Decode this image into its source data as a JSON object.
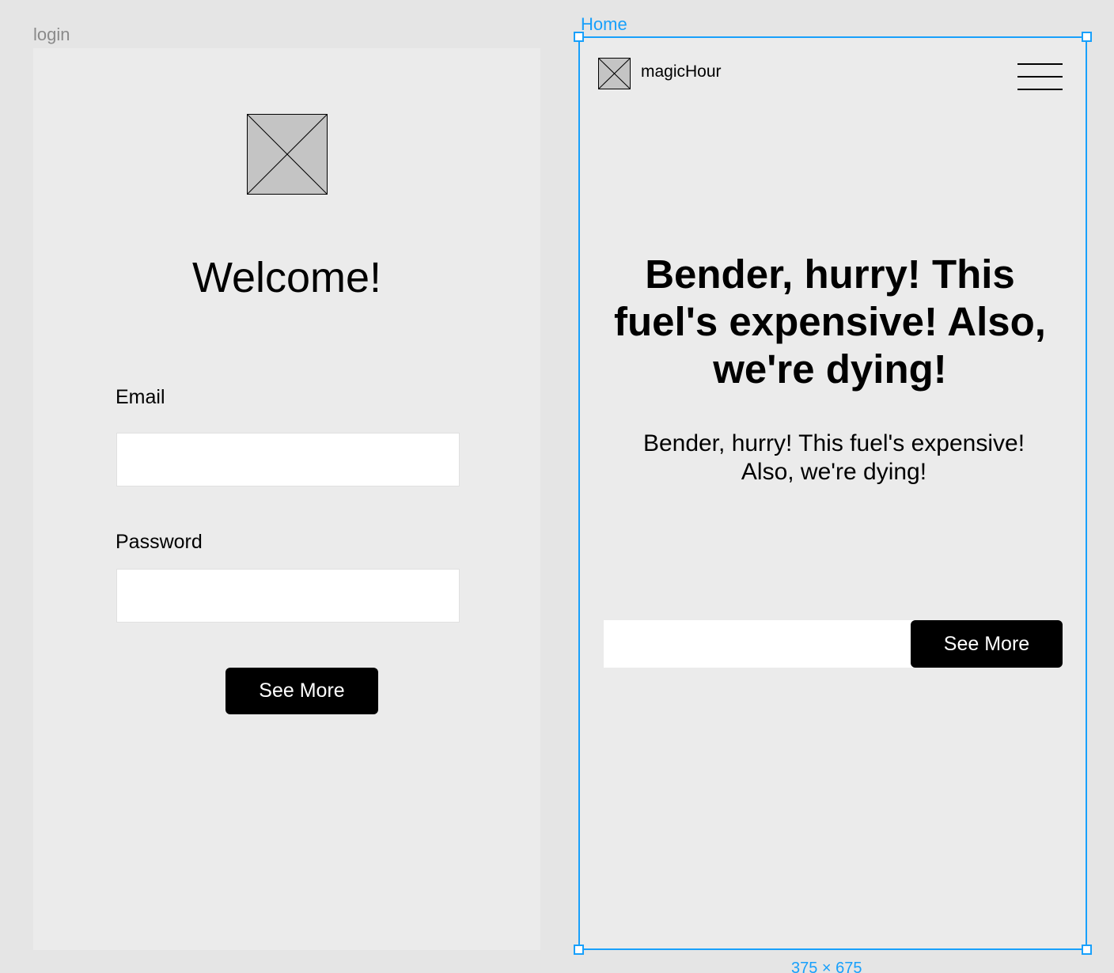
{
  "frames": {
    "login": {
      "label": "login",
      "welcome": "Welcome!",
      "email_label": "Email",
      "email_value": "",
      "password_label": "Password",
      "password_value": "",
      "button_label": "See More"
    },
    "home": {
      "label": "Home",
      "brand": "magicHour",
      "hero_title": "Bender, hurry! This fuel's expensive! Also, we're dying!",
      "hero_subtitle": "Bender, hurry! This fuel's expensive! Also, we're dying!",
      "cta_input_value": "",
      "button_label": "See More"
    }
  },
  "selection": {
    "size_readout": "375 × 675"
  },
  "icons": {
    "image_placeholder": "image-placeholder-icon",
    "menu": "hamburger-menu-icon"
  },
  "colors": {
    "canvas": "#e5e5e5",
    "frame": "#ebebeb",
    "selection": "#18a0fb",
    "button": "#000000",
    "placeholder": "#c4c4c4"
  }
}
